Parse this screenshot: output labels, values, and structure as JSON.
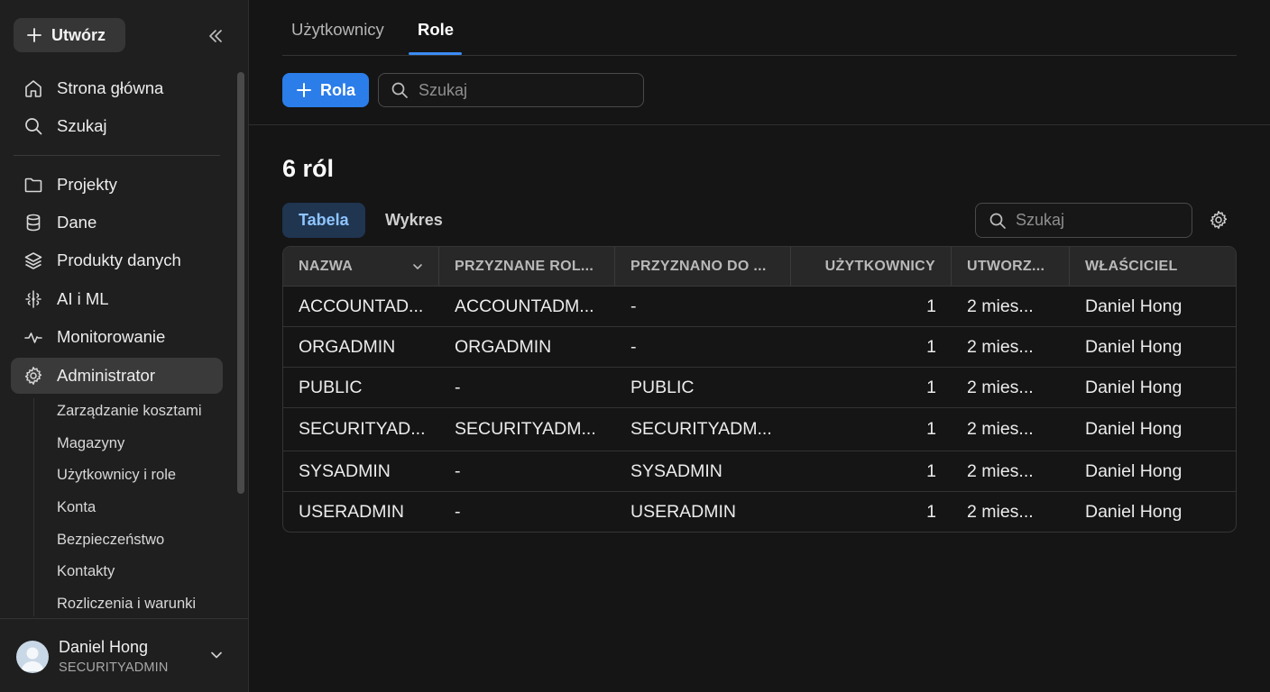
{
  "sidebar": {
    "create_label": "Utwórz",
    "nav": [
      {
        "label": "Strona główna",
        "icon": "home-icon"
      },
      {
        "label": "Szukaj",
        "icon": "search-icon"
      },
      {
        "label": "Projekty",
        "icon": "folder-icon"
      },
      {
        "label": "Dane",
        "icon": "database-icon"
      },
      {
        "label": "Produkty danych",
        "icon": "layers-icon"
      },
      {
        "label": "AI i ML",
        "icon": "ai-icon"
      },
      {
        "label": "Monitorowanie",
        "icon": "activity-icon"
      },
      {
        "label": "Administrator",
        "icon": "gear-icon"
      }
    ],
    "sub_items": [
      "Zarządzanie kosztami",
      "Magazyny",
      "Użytkownicy i role",
      "Konta",
      "Bezpieczeństwo",
      "Kontakty",
      "Rozliczenia i warunki"
    ],
    "user": {
      "name": "Daniel Hong",
      "role": "SECURITYADMIN"
    }
  },
  "tabs": [
    "Użytkownicy",
    "Role"
  ],
  "toolbar": {
    "add_role_label": "Rola",
    "search_placeholder": "Szukaj"
  },
  "main": {
    "count_title": "6 ról",
    "view_tabs": [
      "Tabela",
      "Wykres"
    ],
    "table_search_placeholder": "Szukaj"
  },
  "table": {
    "headers": [
      "NAZWA",
      "PRZYZNANE ROL...",
      "PRZYZNANO DO ...",
      "UŻYTKOWNICY",
      "UTWORZ...",
      "WŁAŚCICIEL"
    ],
    "rows": [
      [
        "ACCOUNTAD...",
        "ACCOUNTADM...",
        "-",
        "1",
        "2 mies...",
        "Daniel Hong"
      ],
      [
        "ORGADMIN",
        "ORGADMIN",
        "-",
        "1",
        "2 mies...",
        "Daniel Hong"
      ],
      [
        "PUBLIC",
        "-",
        "PUBLIC",
        "1",
        "2 mies...",
        "Daniel Hong"
      ],
      [
        "SECURITYAD...",
        "SECURITYADM...",
        "SECURITYADM...",
        "1",
        "2 mies...",
        "Daniel Hong"
      ],
      [
        "SYSADMIN",
        "-",
        "SYSADMIN",
        "1",
        "2 mies...",
        "Daniel Hong"
      ],
      [
        "USERADMIN",
        "-",
        "USERADMIN",
        "1",
        "2 mies...",
        "Daniel Hong"
      ]
    ]
  },
  "colors": {
    "accent": "#2b7de9",
    "active_tab_text": "#8fc4ff",
    "background": "#151515",
    "sidebar": "#1f1f1f"
  }
}
